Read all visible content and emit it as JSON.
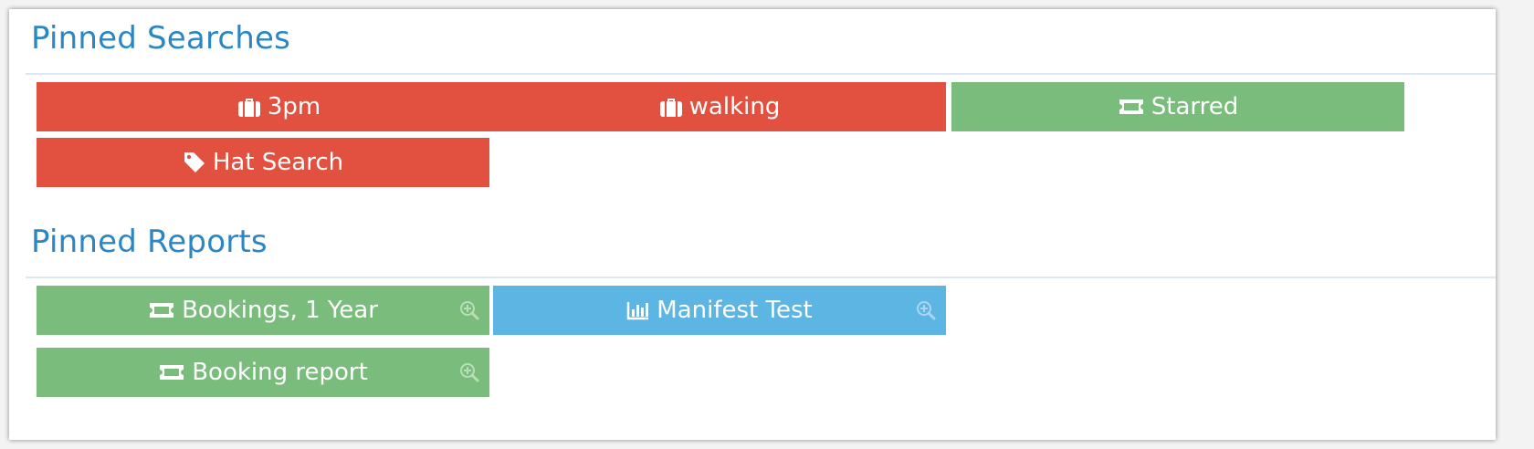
{
  "pinned_searches": {
    "title": "Pinned Searches",
    "items": [
      {
        "label": "3pm",
        "icon": "suitcase-icon",
        "color": "#e25040"
      },
      {
        "label": "walking",
        "icon": "suitcase-icon",
        "color": "#e25040"
      },
      {
        "label": "Starred",
        "icon": "ticket-icon",
        "color": "#7abc7b"
      },
      {
        "label": "Hat Search",
        "icon": "tag-icon",
        "color": "#e25040"
      }
    ]
  },
  "pinned_reports": {
    "title": "Pinned Reports",
    "items": [
      {
        "label": "Bookings, 1 Year",
        "icon": "ticket-icon",
        "color": "#7abc7b",
        "action_icon": "zoom-in-icon"
      },
      {
        "label": "Manifest Test",
        "icon": "bar-chart-icon",
        "color": "#5cb5e3",
        "action_icon": "zoom-in-icon"
      },
      {
        "label": "Booking report",
        "icon": "ticket-icon",
        "color": "#7abc7b",
        "action_icon": "zoom-in-icon"
      }
    ]
  }
}
